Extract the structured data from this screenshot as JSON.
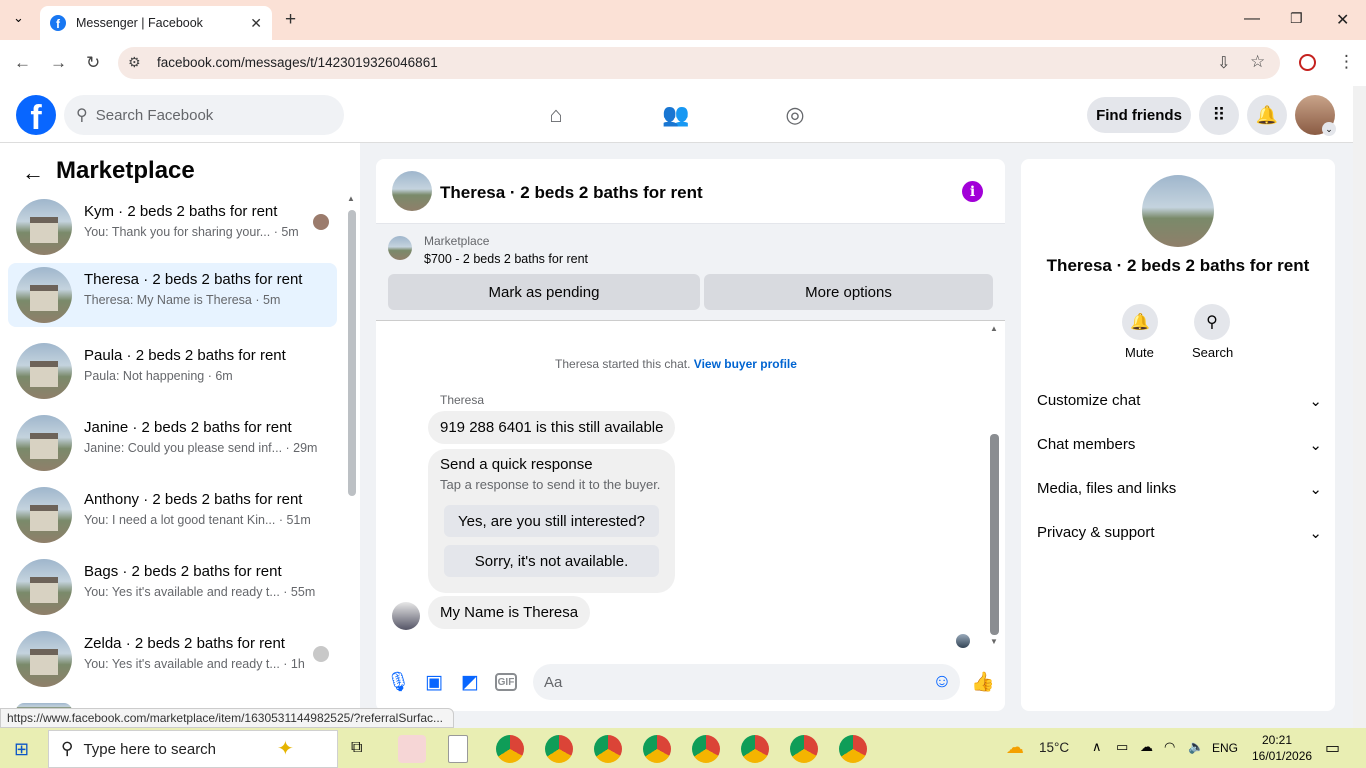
{
  "browser": {
    "tab_title": "Messenger | Facebook",
    "url": "facebook.com/messages/t/1423019326046861",
    "status_link": "https://www.facebook.com/marketplace/item/1630531144982525/?referralSurfac..."
  },
  "header": {
    "search_placeholder": "Search Facebook",
    "find_friends": "Find friends"
  },
  "sidebar": {
    "title": "Marketplace",
    "conversations": [
      {
        "name": "Kym · 2 beds 2 baths for rent",
        "preview": "You: Thank you for sharing your... · 5m"
      },
      {
        "name": "Theresa · 2 beds 2 baths for rent",
        "preview": "Theresa: My Name is Theresa · 5m"
      },
      {
        "name": "Paula · 2 beds 2 baths for rent",
        "preview": "Paula: Not happening · 6m"
      },
      {
        "name": "Janine · 2 beds 2 baths for rent",
        "preview": "Janine: Could you please send inf... · 29m"
      },
      {
        "name": "Anthony · 2 beds 2 baths for rent",
        "preview": "You: I need a lot good tenant Kin... · 51m"
      },
      {
        "name": "Bags · 2 beds 2 baths for rent",
        "preview": "You: Yes it's available and ready t... · 55m"
      },
      {
        "name": "Zelda · 2 beds 2 baths for rent",
        "preview": "You: Yes it's available and ready t... · 1h"
      }
    ]
  },
  "chat": {
    "title": "Theresa · 2 beds 2 baths for rent",
    "listing_label": "Marketplace",
    "listing_price": "$700 - 2 beds 2 baths for rent",
    "mark_pending": "Mark as pending",
    "more_options": "More options",
    "started_text": "Theresa started this chat.",
    "view_profile": "View buyer profile",
    "sender": "Theresa",
    "message1": "919 288 6401 is this still available",
    "quick_title": "Send a quick response",
    "quick_sub": "Tap a response to send it to the buyer.",
    "quick_1": "Yes, are you still interested?",
    "quick_2": "Sorry, it's not available.",
    "message2": "My Name is Theresa",
    "composer_placeholder": "Aa"
  },
  "info_panel": {
    "title": "Theresa · 2 beds 2 baths for rent",
    "mute": "Mute",
    "search": "Search",
    "sections": [
      "Customize chat",
      "Chat members",
      "Media, files and links",
      "Privacy & support"
    ]
  },
  "taskbar": {
    "search_placeholder": "Type here to search",
    "temperature": "15°C",
    "language": "ENG",
    "time": "20:21",
    "date": "16/01/2026"
  },
  "colors": {
    "accent": "#0866ff",
    "info": "#a200d8",
    "tabbar": "#fbe1d6",
    "taskbar": "#e9eeb3"
  }
}
